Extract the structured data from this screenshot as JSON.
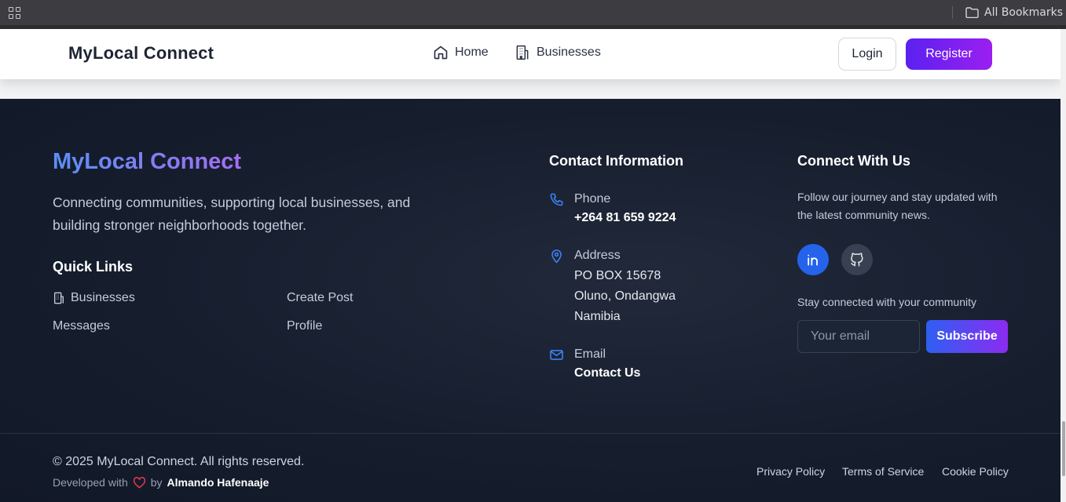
{
  "browser": {
    "bookmarks_label": "All Bookmarks"
  },
  "nav": {
    "brand": "MyLocal Connect",
    "home": "Home",
    "businesses": "Businesses",
    "login": "Login",
    "register": "Register"
  },
  "footer": {
    "brand": "MyLocal Connect",
    "tagline": "Connecting communities, supporting local businesses, and building stronger neighborhoods together.",
    "quick_links_title": "Quick Links",
    "quick_links": {
      "businesses": "Businesses",
      "create_post": "Create Post",
      "messages": "Messages",
      "profile": "Profile"
    },
    "contact": {
      "title": "Contact Information",
      "phone_label": "Phone",
      "phone_value": "+264 81 659 9224",
      "address_label": "Address",
      "address_lines": [
        "PO BOX 15678",
        "Oluno, Ondangwa",
        "Namibia"
      ],
      "email_label": "Email",
      "email_value": "Contact Us"
    },
    "connect": {
      "title": "Connect With Us",
      "text": "Follow our journey and stay updated with the latest community news.",
      "stay": "Stay connected with your community",
      "email_placeholder": "Your email",
      "subscribe": "Subscribe"
    },
    "bottom": {
      "copyright": "© 2025 MyLocal Connect. All rights reserved.",
      "developed_with": "Developed with",
      "by": "by",
      "author": "Almando Hafenaaje",
      "privacy": "Privacy Policy",
      "terms": "Terms of Service",
      "cookie": "Cookie Policy"
    }
  }
}
